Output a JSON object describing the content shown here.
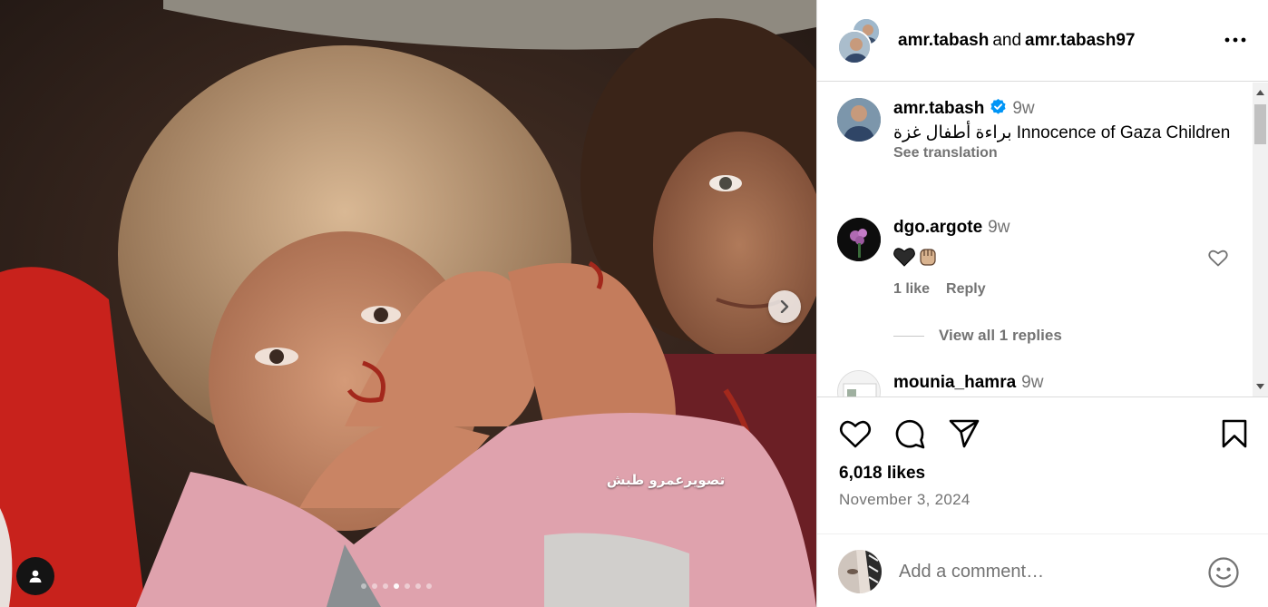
{
  "media": {
    "watermark": "تصويرعمرو طبش",
    "slide_count": 7,
    "active_slide": 3
  },
  "header": {
    "user1": "amr.tabash",
    "conjunction": "and",
    "user2": "amr.tabash97"
  },
  "caption": {
    "username": "amr.tabash",
    "time": "9w",
    "text": "براءة أطفال غزة Innocence of Gaza Children",
    "see_translation": "See translation"
  },
  "comments": [
    {
      "username": "dgo.argote",
      "time": "9w",
      "emoji": [
        "black-heart",
        "raised-fist-medium-light-skin"
      ],
      "likes": "1 like",
      "reply": "Reply",
      "view_replies": "View all 1 replies"
    },
    {
      "username": "mounia_hamra",
      "time": "9w"
    }
  ],
  "likes": "6,018 likes",
  "date": "November 3, 2024",
  "add_comment": {
    "placeholder": "Add a comment…"
  },
  "colors": {
    "verified": "#0095f6",
    "secondary_text": "#737373",
    "divider": "#dbdbdb"
  },
  "icons": {
    "like": "heart-icon",
    "comment": "comment-bubble-icon",
    "share": "paper-plane-icon",
    "save": "bookmark-icon",
    "more": "three-dots-icon",
    "next": "chevron-right-icon",
    "tags": "user-tag-icon",
    "emoji": "smiley-icon"
  }
}
